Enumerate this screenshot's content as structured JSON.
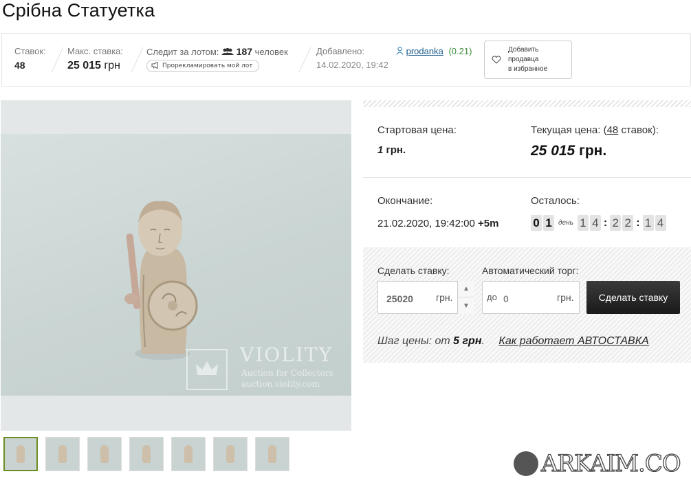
{
  "title": "Срібна Статуетка",
  "info": {
    "bids_label": "Ставок:",
    "bids_value": "48",
    "max_bid_label": "Макс. ставка:",
    "max_bid_value": "25 015",
    "max_bid_currency": "грн",
    "watch_label": "Следит за лотом:",
    "watch_count": "187",
    "watch_suffix": "человек",
    "promo_label": "Прорекламировать мой лот",
    "added_label": "Добавлено:",
    "added_value": "14.02.2020, 19:42",
    "seller_name": "prodanka",
    "seller_rating": "(0.21)",
    "fav_line1": "Добавить",
    "fav_line2": "продавца",
    "fav_line3": "в избранное"
  },
  "watermark": {
    "name": "VIOLITY",
    "sub1": "Auction for Collectors",
    "sub2": "auction.violity.com"
  },
  "thumbnails": [
    {
      "active": true
    },
    {
      "active": false
    },
    {
      "active": false
    },
    {
      "active": false
    },
    {
      "active": false
    },
    {
      "active": false
    },
    {
      "active": false
    }
  ],
  "price": {
    "start_label": "Стартовая цена:",
    "start_value": "1",
    "start_currency": "грн.",
    "current_label_pre": "Текущая цена: (",
    "current_bids_link": "48",
    "current_label_post": " ставок):",
    "current_value": "25 015",
    "current_currency": "грн."
  },
  "end": {
    "label": "Окончание:",
    "date": "21.02.2020, 19:42:00",
    "extra": "+5m",
    "left_label": "Осталось:",
    "days": [
      "0",
      "1"
    ],
    "day_unit": "день",
    "hours": [
      "1",
      "4"
    ],
    "minutes": [
      "2",
      "2"
    ],
    "seconds": [
      "1",
      "4"
    ],
    "colon": ":"
  },
  "bid": {
    "make_label": "Сделать ставку:",
    "amount": "25020",
    "currency": "грн.",
    "auto_label": "Автоматический торг:",
    "auto_prefix": "до",
    "auto_value": "0",
    "auto_currency": "грн.",
    "submit_label": "Сделать ставку",
    "step_label": "Шаг цены: от",
    "step_value": "5 грн",
    "step_dot": ".",
    "how_link": "Как работает АВТОСТАВКА"
  },
  "footer_logo": "ARKAIM.CO"
}
